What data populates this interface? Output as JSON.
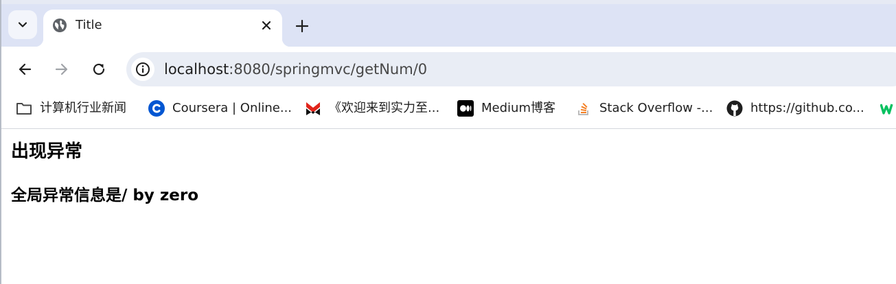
{
  "tab": {
    "title": "Title"
  },
  "toolbar": {
    "url_host": "localhost",
    "url_rest": ":8080/springmvc/getNum/0"
  },
  "bookmarks": [
    {
      "label": "计算机行业新闻",
      "icon": "folder-icon"
    },
    {
      "label": "Coursera | Online...",
      "icon": "coursera-icon"
    },
    {
      "label": "《欢迎来到实力至...",
      "icon": "anime-site-icon"
    },
    {
      "label": "Medium博客",
      "icon": "medium-icon"
    },
    {
      "label": "Stack Overflow -...",
      "icon": "stackoverflow-icon"
    },
    {
      "label": "https://github.co...",
      "icon": "github-icon"
    }
  ],
  "page": {
    "heading": "出现异常",
    "message": "全局异常信息是/ by zero"
  },
  "colors": {
    "tabstrip": "#dde3f5",
    "omnibox": "#e9edf5",
    "coursera": "#0056d2",
    "stackoverflow": "#f48024",
    "anime_red": "#e1251b"
  }
}
